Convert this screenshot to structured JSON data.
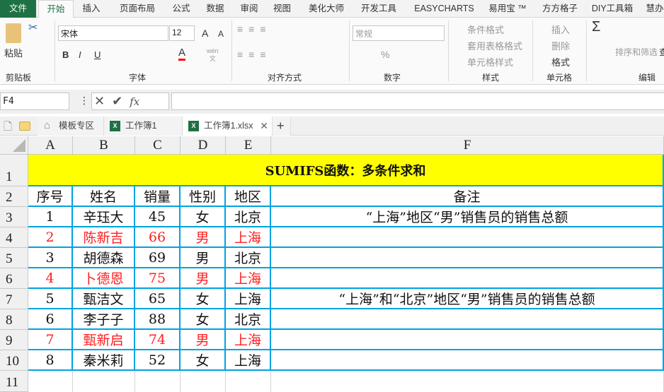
{
  "menu": {
    "file": "文件",
    "tabs": [
      "开始",
      "插入",
      "页面布局",
      "公式",
      "数据",
      "审阅",
      "视图",
      "美化大师",
      "开发工具",
      "EASYCHARTS",
      "易用宝 ™",
      "方方格子",
      "DIY工具箱",
      "慧办"
    ]
  },
  "ribbon": {
    "clipboard": {
      "paste": "粘贴",
      "label": "剪贴板"
    },
    "font": {
      "name": "宋体",
      "size": "12",
      "label": "字体",
      "bold": "B",
      "italic": "I",
      "underline": "U",
      "grow": "A",
      "shrink": "A",
      "color_a": "A",
      "wen": "wén\n文"
    },
    "align": {
      "label": "对齐方式"
    },
    "number": {
      "format": "常规",
      "label": "数字",
      "percent": "%",
      "comma": ","
    },
    "styles": {
      "cond": "条件格式",
      "table": "套用表格格式",
      "cell": "单元格样式",
      "label": "样式"
    },
    "cells": {
      "insert": "插入",
      "delete": "删除",
      "format": "格式",
      "label": "单元格"
    },
    "edit": {
      "sum": "Σ",
      "sort": "排序和筛选",
      "find": "查",
      "label": "编辑"
    }
  },
  "formula_bar": {
    "name_box": "F4",
    "fx": "fx",
    "value": ""
  },
  "doc_tabs": [
    "模板专区",
    "工作簿1",
    "工作簿1.xlsx"
  ],
  "columns": [
    "A",
    "B",
    "C",
    "D",
    "E",
    "F"
  ],
  "rows": [
    "1",
    "2",
    "3",
    "4",
    "5",
    "6",
    "7",
    "8",
    "9",
    "10",
    "11"
  ],
  "sheet": {
    "title": "SUMIFS函数：多条件求和",
    "headers": [
      "序号",
      "姓名",
      "销量",
      "性别",
      "地区",
      "备注"
    ],
    "data": [
      {
        "no": "1",
        "name": "辛珏大",
        "sales": "45",
        "sex": "女",
        "region": "北京",
        "note": "“上海”地区“男”销售员的销售总额",
        "red": false
      },
      {
        "no": "2",
        "name": "陈新吉",
        "sales": "66",
        "sex": "男",
        "region": "上海",
        "note": "",
        "red": true
      },
      {
        "no": "3",
        "name": "胡德森",
        "sales": "69",
        "sex": "男",
        "region": "北京",
        "note": "",
        "red": false
      },
      {
        "no": "4",
        "name": "卜德恩",
        "sales": "75",
        "sex": "男",
        "region": "上海",
        "note": "",
        "red": true
      },
      {
        "no": "5",
        "name": "甄洁文",
        "sales": "65",
        "sex": "女",
        "region": "上海",
        "note": "“上海”和“北京”地区“男”销售员的销售总额",
        "red": false
      },
      {
        "no": "6",
        "name": "李子子",
        "sales": "88",
        "sex": "女",
        "region": "北京",
        "note": "",
        "red": false
      },
      {
        "no": "7",
        "name": "甄新启",
        "sales": "74",
        "sex": "男",
        "region": "上海",
        "note": "",
        "red": true
      },
      {
        "no": "8",
        "name": "秦米莉",
        "sales": "52",
        "sex": "女",
        "region": "上海",
        "note": "",
        "red": false
      }
    ]
  },
  "colors": {
    "accent": "#1e7145",
    "border": "#00a3e0",
    "highlight": "#ffff00",
    "red": "#ff2020"
  }
}
